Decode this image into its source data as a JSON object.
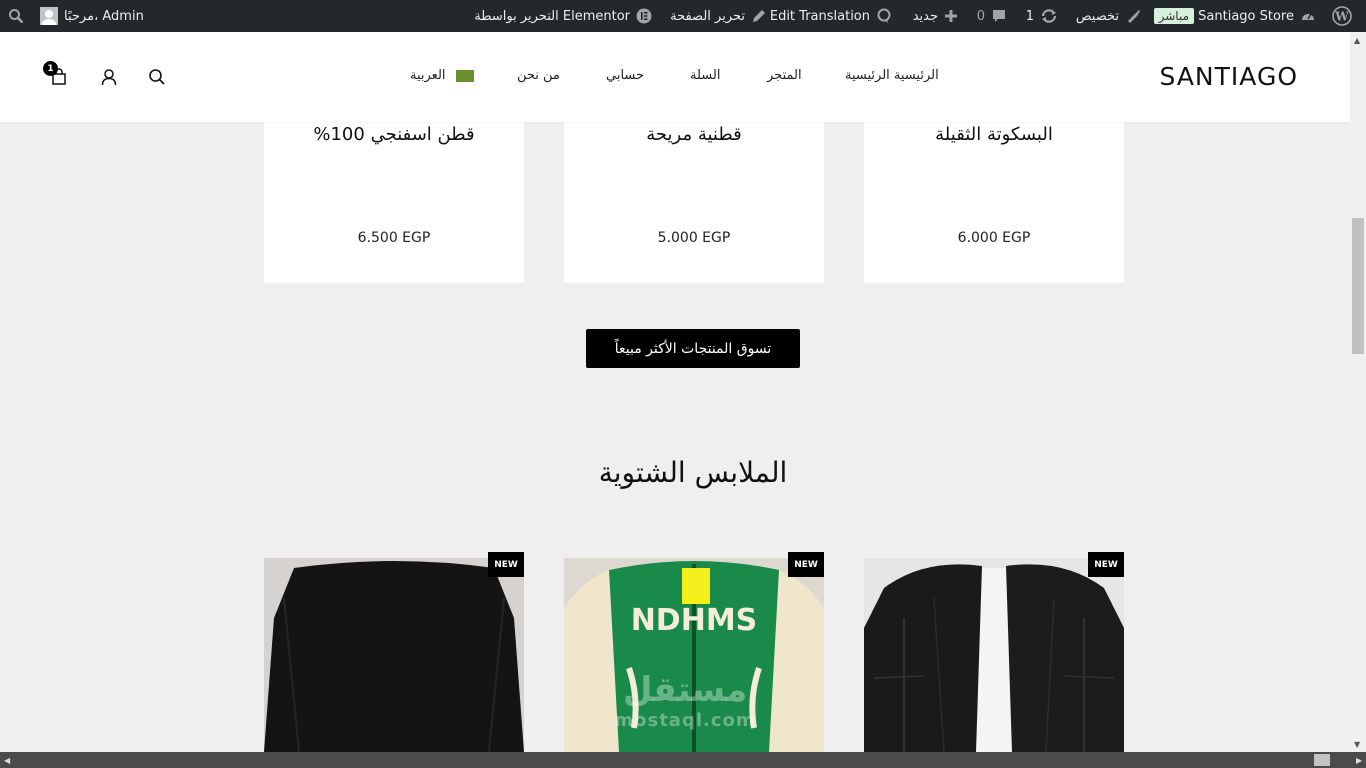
{
  "admin_bar": {
    "site_name": "Santiago Store",
    "live_badge": "مباشر",
    "customize": "تخصيص",
    "updates_count": "1",
    "comments_count": "0",
    "new": "جديد",
    "edit_translation": "Edit Translation",
    "edit_page": "تحرير الصفحة",
    "elementor_edit": "التحرير بواسطة Elementor",
    "greeting": "مرحبًا، Admin"
  },
  "header": {
    "logo": "SANTIAGO",
    "nav": {
      "home": "الرئيسية الرئيسية",
      "shop": "المتجر",
      "cart": "السلة",
      "account": "حسابي",
      "about": "من نحن",
      "language": "العربية"
    },
    "cart_count": "1"
  },
  "products_top": [
    {
      "name": "البسكوتة الثقيلة",
      "price": "6.000 EGP"
    },
    {
      "name": "قطنية مريحة",
      "price": "5.000 EGP"
    },
    {
      "name": "قطن اسفنجي 100%",
      "price": "6.500 EGP"
    }
  ],
  "cta_label": "تسوق المنتجات الأكثر مبيعاً",
  "section_title": "الملابس الشتوية",
  "winter_products": [
    {
      "badge": "NEW",
      "image": "black-leather-jacket"
    },
    {
      "badge": "NEW",
      "image": "green-varsity-jacket"
    },
    {
      "badge": "NEW",
      "image": "black-sweater"
    }
  ],
  "watermark": {
    "ar": "مستقل",
    "en": "mostaql.com"
  },
  "colors": {
    "admin_bar": "#23282d",
    "page_bg": "#efefef",
    "button": "#000000",
    "varsity_green": "#1a8a4a"
  }
}
